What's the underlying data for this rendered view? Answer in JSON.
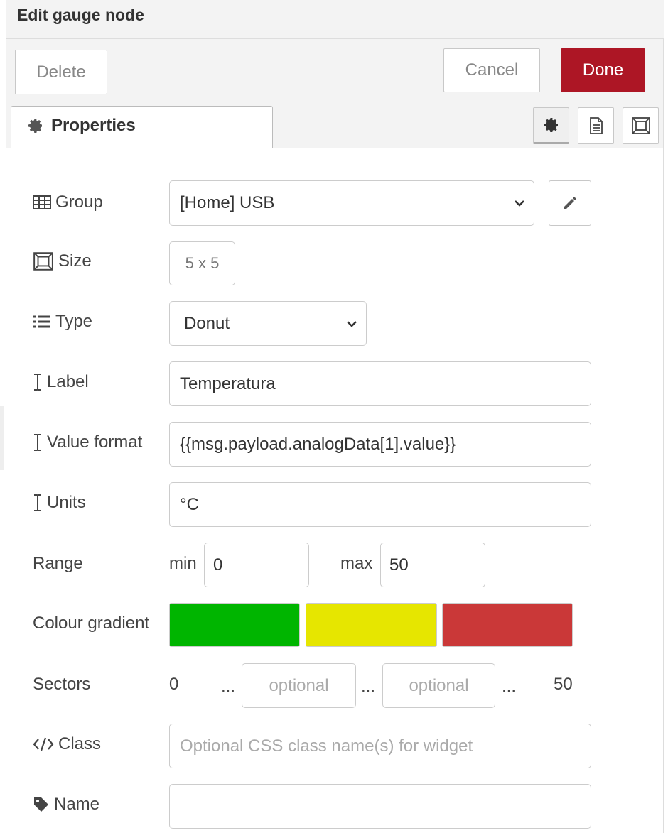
{
  "dialog": {
    "title": "Edit gauge node",
    "delete_label": "Delete",
    "cancel_label": "Cancel",
    "done_label": "Done"
  },
  "tabs": [
    {
      "label": "Properties",
      "icon": "gear-icon",
      "active": true
    }
  ],
  "tab_icons": [
    "gear-icon",
    "document-icon",
    "frame-icon"
  ],
  "form": {
    "group": {
      "label": "Group",
      "value": "[Home] USB",
      "icon": "table-icon"
    },
    "size": {
      "label": "Size",
      "value": "5 x 5",
      "icon": "frame-icon"
    },
    "type": {
      "label": "Type",
      "value": "Donut",
      "icon": "list-icon"
    },
    "label_field": {
      "label": "Label",
      "value": "Temperatura",
      "icon": "text-cursor-icon"
    },
    "value_format": {
      "label": "Value format",
      "value": "{{msg.payload.analogData[1].value}}",
      "icon": "text-cursor-icon"
    },
    "units": {
      "label": "Units",
      "value": "°C",
      "icon": "text-cursor-icon"
    },
    "range": {
      "label": "Range",
      "min_label": "min",
      "min_value": "0",
      "max_label": "max",
      "max_value": "50"
    },
    "colour_gradient": {
      "label": "Colour gradient",
      "colors": [
        "#00b500",
        "#e6e600",
        "#ca3838"
      ]
    },
    "sectors": {
      "label": "Sectors",
      "start": "0",
      "sep": "...",
      "placeholder1": "optional",
      "placeholder2": "optional",
      "end": "50"
    },
    "class": {
      "label": "Class",
      "placeholder": "Optional CSS class name(s) for widget",
      "icon": "code-icon"
    },
    "name": {
      "label": "Name",
      "value": "",
      "icon": "tag-icon"
    }
  },
  "colors": {
    "primary": "#ad1625",
    "border": "#cccccc",
    "tray_bg": "#f3f3f3"
  }
}
